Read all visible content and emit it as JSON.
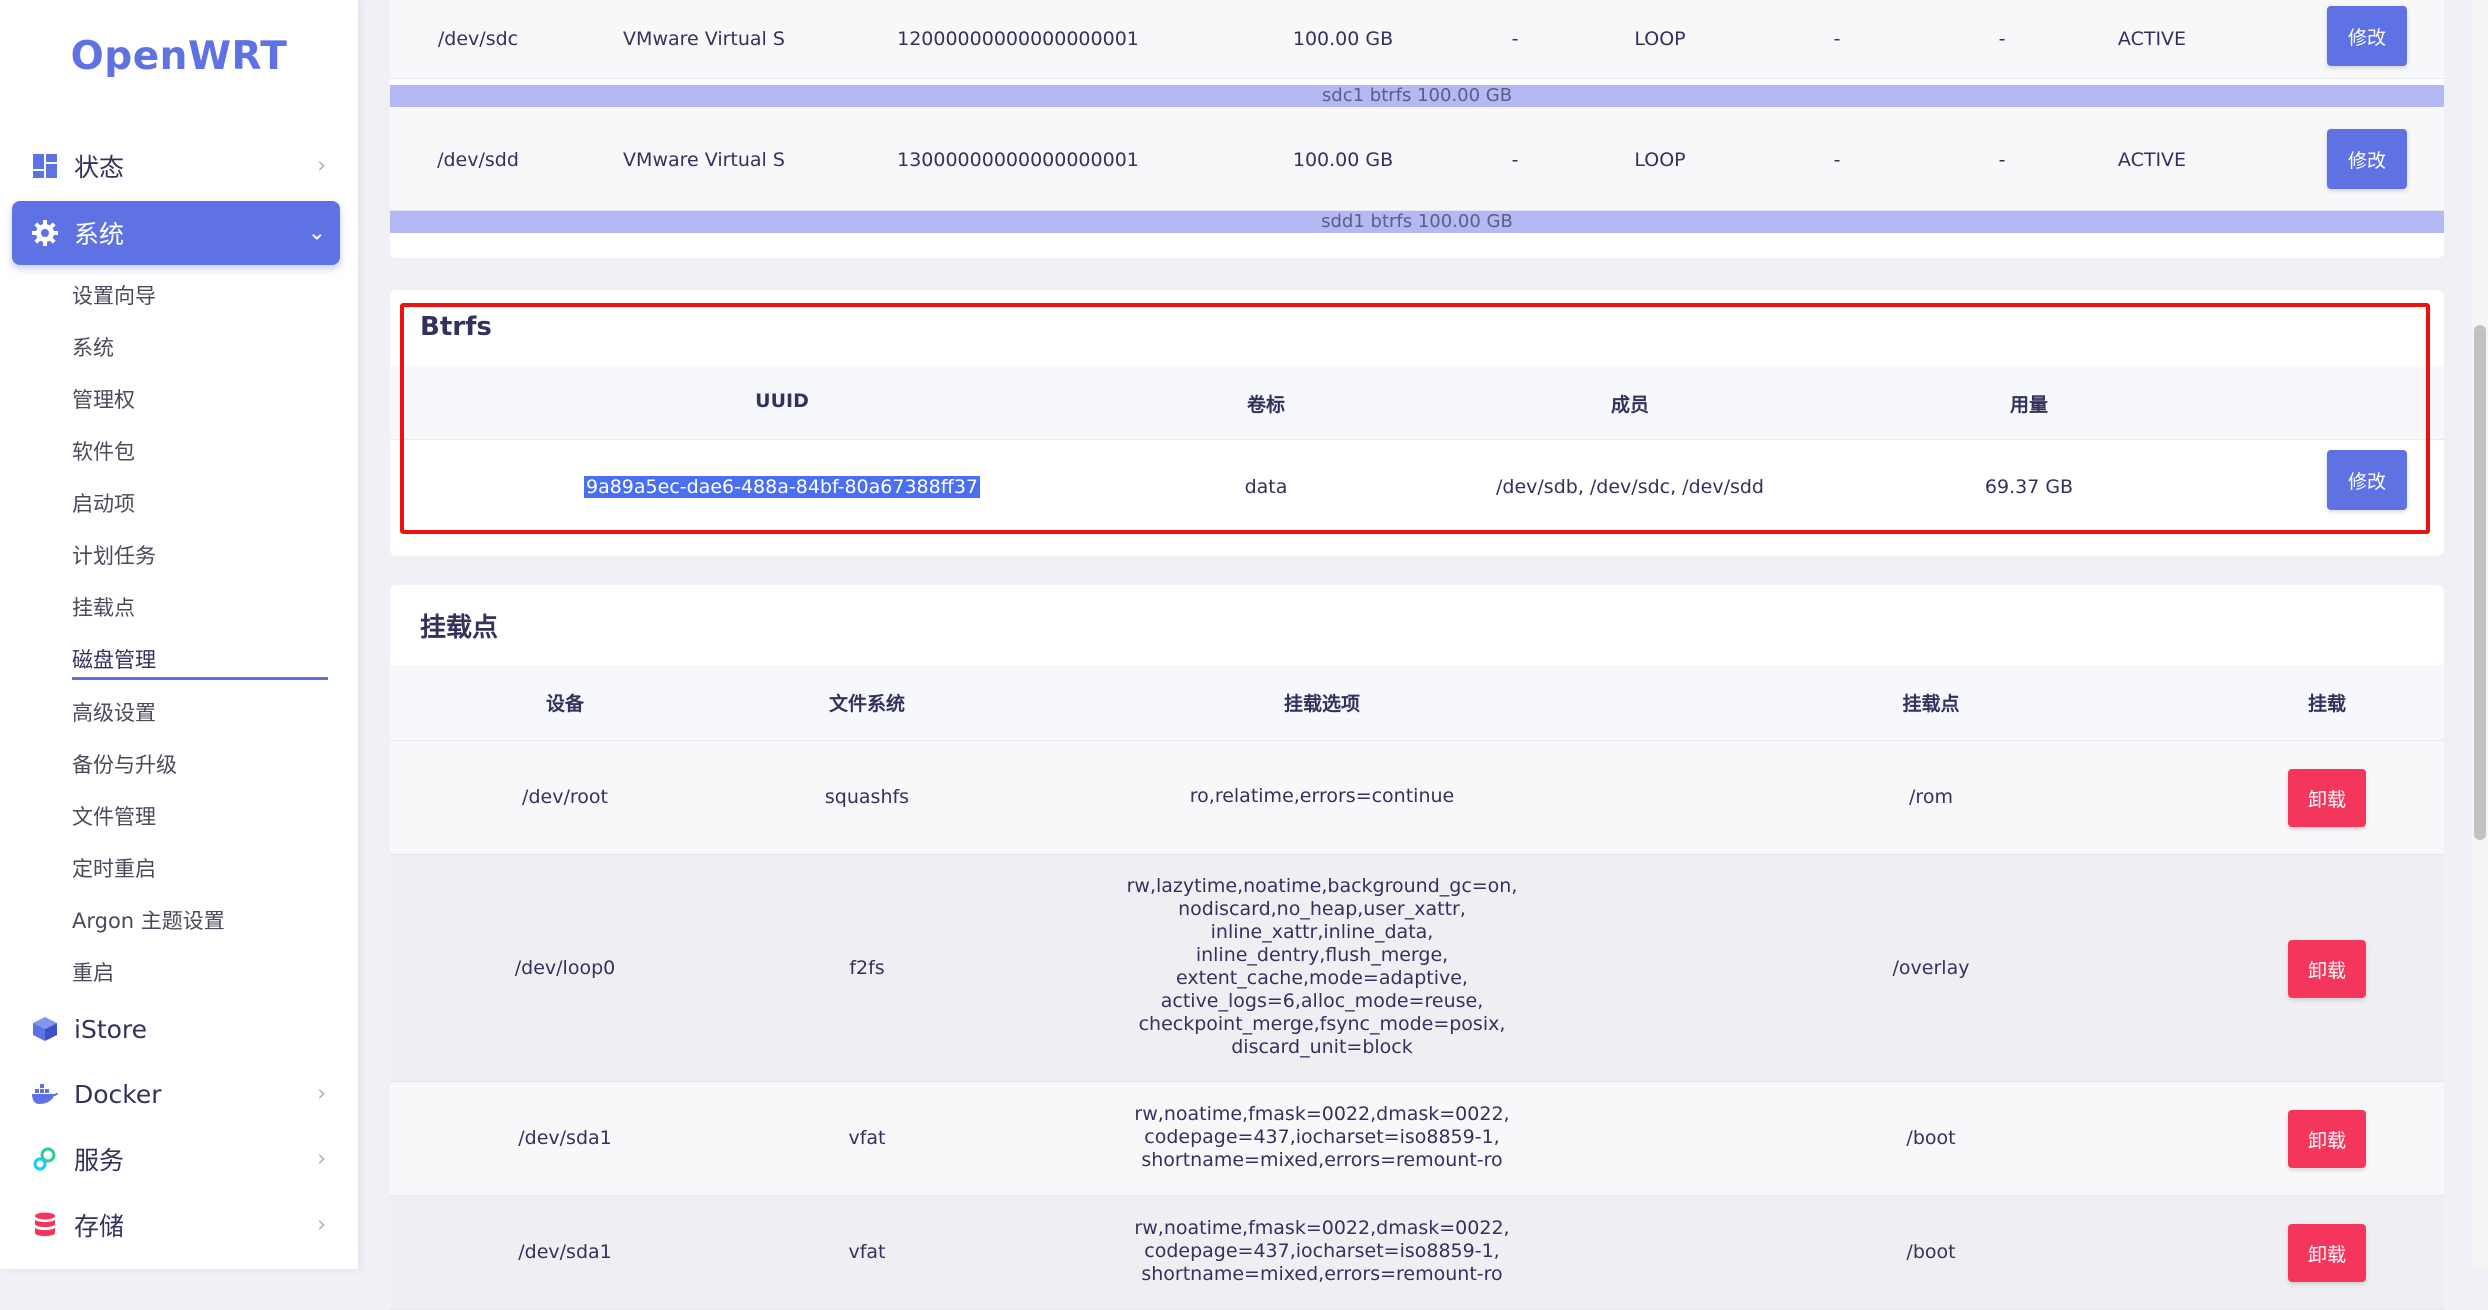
{
  "app": {
    "brand": "OpenWRT"
  },
  "sidebar": {
    "top": [
      {
        "label": "状态",
        "icon": "dashboard-icon"
      },
      {
        "label": "系统",
        "icon": "gear-icon"
      }
    ],
    "sub": [
      "设置向导",
      "系统",
      "管理权",
      "软件包",
      "启动项",
      "计划任务",
      "挂载点",
      "磁盘管理",
      "高级设置",
      "备份与升级",
      "文件管理",
      "定时重启",
      "Argon 主题设置",
      "重启"
    ],
    "active_sub": "磁盘管理",
    "bottom": [
      {
        "label": "iStore",
        "icon": "cube-icon"
      },
      {
        "label": "Docker",
        "icon": "docker-icon"
      },
      {
        "label": "服务",
        "icon": "services-icon"
      },
      {
        "label": "存储",
        "icon": "database-icon"
      }
    ]
  },
  "disks": {
    "rows": [
      {
        "path": "/dev/sdc",
        "model": "VMware Virtual S",
        "serial": "12000000000000000001",
        "size": "100.00 GB",
        "c5": "-",
        "type": "LOOP",
        "c7": "-",
        "c8": "-",
        "status": "ACTIVE",
        "action": "修改",
        "partition": "sdc1 btrfs 100.00 GB"
      },
      {
        "path": "/dev/sdd",
        "model": "VMware Virtual S",
        "serial": "13000000000000000001",
        "size": "100.00 GB",
        "c5": "-",
        "type": "LOOP",
        "c7": "-",
        "c8": "-",
        "status": "ACTIVE",
        "action": "修改",
        "partition": "sdd1 btrfs 100.00 GB"
      }
    ]
  },
  "btrfs": {
    "title": "Btrfs",
    "headers": {
      "uuid": "UUID",
      "label": "卷标",
      "members": "成员",
      "usage": "用量"
    },
    "row": {
      "uuid": "9a89a5ec-dae6-488a-84bf-80a67388ff37",
      "label": "data",
      "members": "/dev/sdb, /dev/sdc, /dev/sdd",
      "usage": "69.37 GB",
      "action": "修改"
    }
  },
  "mounts": {
    "title": "挂载点",
    "headers": {
      "device": "设备",
      "fs": "文件系统",
      "options": "挂载选项",
      "mountpoint": "挂载点",
      "action": "挂载"
    },
    "rows": [
      {
        "device": "/dev/root",
        "fs": "squashfs",
        "options": [
          "ro,relatime,errors=continue"
        ],
        "mountpoint": "/rom",
        "action": "卸载"
      },
      {
        "device": "/dev/loop0",
        "fs": "f2fs",
        "options": [
          "rw,lazytime,noatime,background_gc=on,",
          "nodiscard,no_heap,user_xattr,",
          "inline_xattr,inline_data,",
          "inline_dentry,flush_merge,",
          "extent_cache,mode=adaptive,",
          "active_logs=6,alloc_mode=reuse,",
          "checkpoint_merge,fsync_mode=posix,",
          "discard_unit=block"
        ],
        "mountpoint": "/overlay",
        "action": "卸载"
      },
      {
        "device": "/dev/sda1",
        "fs": "vfat",
        "options": [
          "rw,noatime,fmask=0022,dmask=0022,",
          "codepage=437,iocharset=iso8859-1,",
          "shortname=mixed,errors=remount-ro"
        ],
        "mountpoint": "/boot",
        "action": "卸载"
      },
      {
        "device": "/dev/sda1",
        "fs": "vfat",
        "options": [
          "rw,noatime,fmask=0022,dmask=0022,",
          "codepage=437,iocharset=iso8859-1,",
          "shortname=mixed,errors=remount-ro"
        ],
        "mountpoint": "/boot",
        "action": "卸载"
      }
    ]
  },
  "colors": {
    "accent": "#5e72e4",
    "danger": "#f5365c",
    "highlight": "#ee1111"
  }
}
